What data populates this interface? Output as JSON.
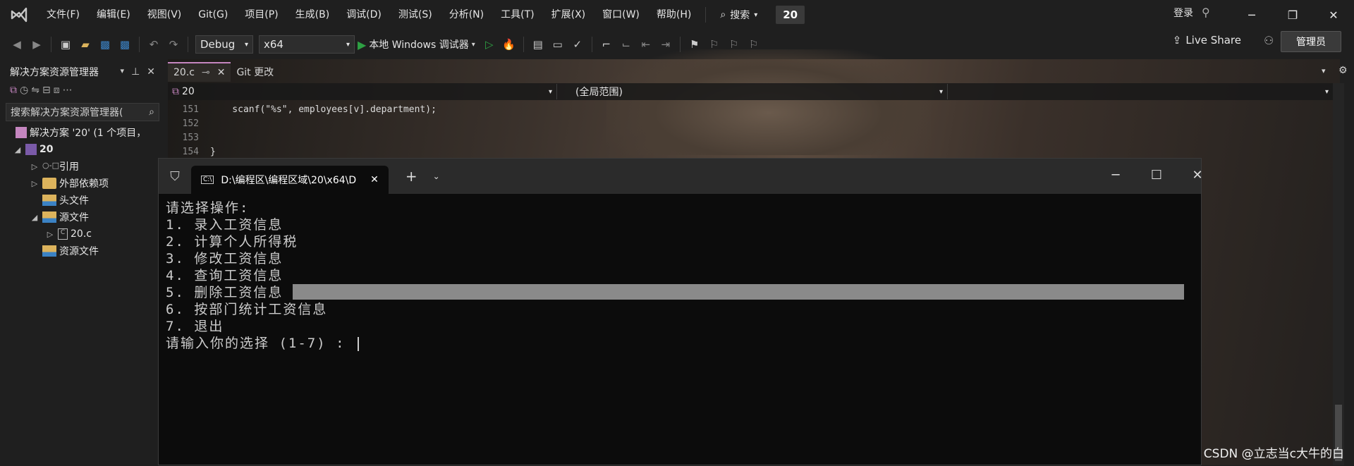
{
  "menubar": {
    "items": [
      "文件(F)",
      "编辑(E)",
      "视图(V)",
      "Git(G)",
      "项目(P)",
      "生成(B)",
      "调试(D)",
      "测试(S)",
      "分析(N)",
      "工具(T)",
      "扩展(X)",
      "窗口(W)",
      "帮助(H)"
    ],
    "search_label": "搜索",
    "solution_badge": "20",
    "login_label": "登录"
  },
  "toolbar": {
    "configuration": "Debug",
    "platform": "x64",
    "debugger_label": "本地 Windows 调试器",
    "live_share": "Live Share",
    "admin_label": "管理员"
  },
  "solution_explorer": {
    "title": "解决方案资源管理器",
    "search_placeholder": "搜索解决方案资源管理器(",
    "solution_label": "解决方案 '20' (1 个项目，",
    "project": "20",
    "items": [
      {
        "label": "引用"
      },
      {
        "label": "外部依赖项"
      },
      {
        "label": "头文件"
      },
      {
        "label": "源文件"
      },
      {
        "label": "20.c"
      },
      {
        "label": "资源文件"
      }
    ]
  },
  "editor": {
    "tabs": [
      {
        "label": "20.c"
      },
      {
        "label": "Git 更改"
      }
    ],
    "nav_file": "20",
    "nav_scope": "(全局范围)",
    "lines": [
      {
        "num": "151",
        "code": "    scanf(\"%s\", employees[v].department);"
      },
      {
        "num": "152",
        "code": ""
      },
      {
        "num": "153",
        "code": ""
      },
      {
        "num": "154",
        "code": "}"
      }
    ]
  },
  "terminal": {
    "tab_title": "D:\\编程区\\编程区域\\20\\x64\\D",
    "lines": [
      "请选择操作:",
      "1. 录入工资信息",
      "2. 计算个人所得税",
      "3. 修改工资信息",
      "4. 查询工资信息",
      "5. 删除工资信息",
      "6. 按部门统计工资信息",
      "7. 退出",
      "请输入你的选择 (1-7) : "
    ]
  },
  "watermark": "CSDN @立志当c大牛的白"
}
